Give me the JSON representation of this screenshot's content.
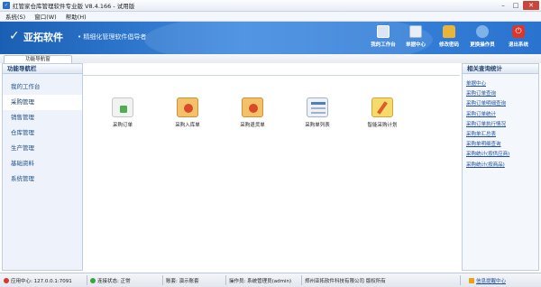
{
  "window": {
    "title": "红管家仓库管理软件专业版 V8.4.166 - 试用版",
    "minimize": "–",
    "maximize": "□",
    "close": "✕"
  },
  "menu": [
    "系统(S)",
    "窗口(W)",
    "帮助(H)"
  ],
  "banner": {
    "logo": "亚拓软件",
    "slogan": "• 精细化管理软件倡导者",
    "tools": [
      {
        "label": "我的工作台",
        "icon": "monitor-icon",
        "color": "#d8e6f5"
      },
      {
        "label": "单据中心",
        "icon": "document-center-icon",
        "color": "#e6eef8"
      },
      {
        "label": "修改密码",
        "icon": "lock-icon",
        "color": "#e8b43a"
      },
      {
        "label": "更换操作员",
        "icon": "user-switch-icon",
        "color": "#7fb2e8"
      },
      {
        "label": "退出系统",
        "icon": "power-icon",
        "color": "#d9372c"
      }
    ]
  },
  "tab": {
    "label": "功能导航窗"
  },
  "leftnav": {
    "title": "功能导航栏",
    "items": [
      "我的工作台",
      "采购管理",
      "销售管理",
      "仓库管理",
      "生产管理",
      "基础资料",
      "系统管理"
    ],
    "active_index": 1
  },
  "functions": [
    {
      "label": "采购订单",
      "icon": "purchase-order-icon",
      "color": "#f2f2f2",
      "accent": "#4caf50"
    },
    {
      "label": "采购入库单",
      "icon": "purchase-inbound-icon",
      "color": "#f3c16a",
      "accent": "#d94a2a"
    },
    {
      "label": "采购退货单",
      "icon": "purchase-return-icon",
      "color": "#f3c16a",
      "accent": "#d94a2a"
    },
    {
      "label": "采购单列表",
      "icon": "purchase-list-icon",
      "color": "#eef2f6",
      "accent": "#4a7fc1"
    },
    {
      "label": "智能采购计划",
      "icon": "smart-plan-icon",
      "color": "#f5dc6a",
      "accent": "#e05a2a"
    }
  ],
  "rightpanel": {
    "title": "相关查询统计",
    "items": [
      "单据中心",
      "采购订单查询",
      "采购订单明细查询",
      "采购订单统计",
      "采购订单执行情况",
      "采购单汇总表",
      "采购单明细查询",
      "采购统计(按供应商)",
      "采购统计(按商品)"
    ]
  },
  "status": {
    "app_center": "应用中心: 127.0.0.1:7091",
    "connection": "连接状态: 正常",
    "account": "账套: 演示账套",
    "operator": "操作员: 系统管理员(admin)",
    "copyright": "郑州亚拓软件科技有限公司 版权所有",
    "message_center": "信息提醒中心",
    "colors": {
      "app": "#d9372c",
      "conn": "#3aa53a",
      "msg": "#e6a317"
    }
  }
}
